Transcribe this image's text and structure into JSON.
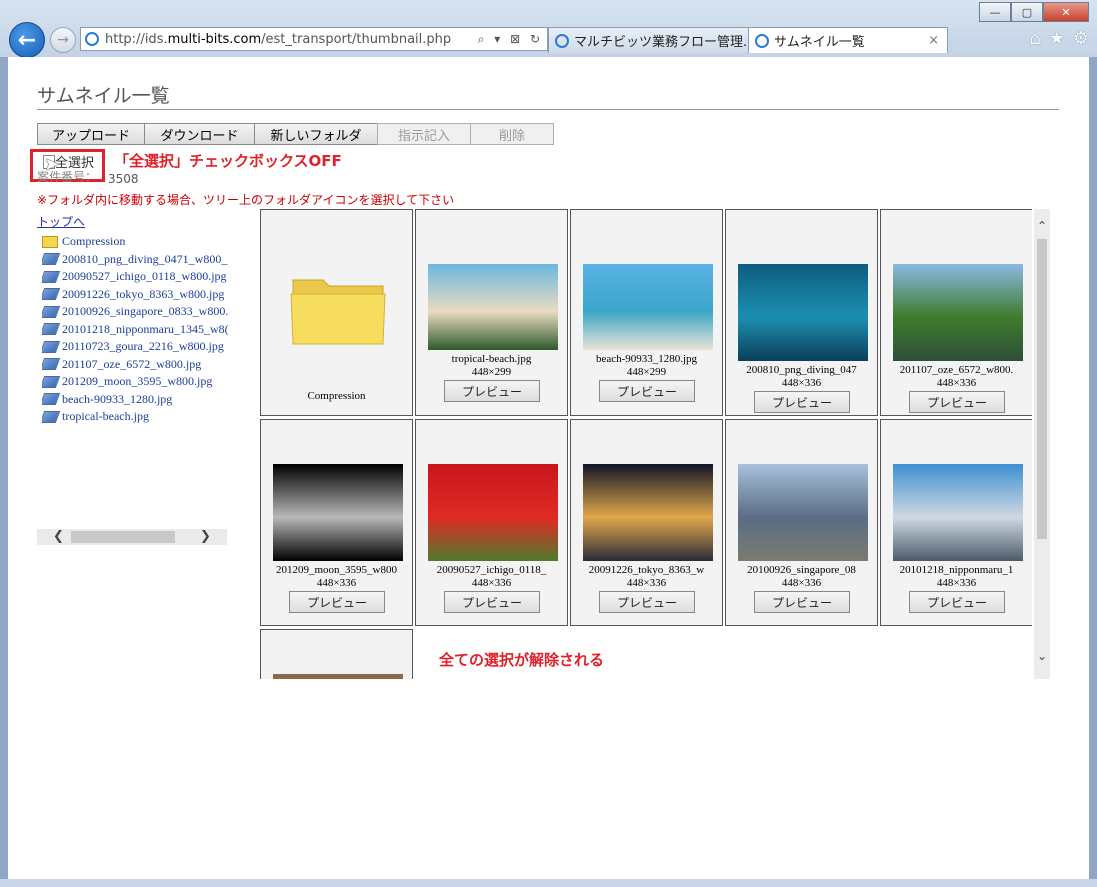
{
  "browser": {
    "url_prefix": "http://ids.",
    "url_host": "multi-bits.com",
    "url_path": "/est_transport/thumbnail.php",
    "url_tools": "⌕ ▾ ⊠ ↻",
    "tabs": [
      {
        "label": "マルチビッツ業務フロー管理..."
      },
      {
        "label": "サムネイル一覧",
        "close": "×"
      }
    ],
    "window_controls": [
      "—",
      "▢",
      "✕"
    ],
    "back_glyph": "←",
    "fwd_glyph": "→",
    "home_glyph": "⌂",
    "star_glyph": "★",
    "gear_glyph": "⚙"
  },
  "page": {
    "title": "サムネイル一覧",
    "toolbar": {
      "upload": "アップロード",
      "download": "ダウンロード",
      "new_folder": "新しいフォルダ",
      "instruction": "指示記入",
      "delete": "削除"
    },
    "select_all_label": "全選択",
    "count_label": "案件番号：",
    "count_value": "3508",
    "annotation_top": "「全選択」チェックボックスOFF",
    "warning": "※フォルダ内に移動する場合、ツリー上のフォルダアイコンを選択して下さい",
    "to_top": "トップへ",
    "annotation_bottom": "全ての選択が解除される"
  },
  "tree": [
    {
      "label": "Compression",
      "icon": "folder-icon"
    },
    {
      "label": "200810_png_diving_0471_w800_",
      "icon": "image-file-icon"
    },
    {
      "label": "20090527_ichigo_0118_w800.jpg",
      "icon": "image-file-icon"
    },
    {
      "label": "20091226_tokyo_8363_w800.jpg",
      "icon": "image-file-icon"
    },
    {
      "label": "20100926_singapore_0833_w800.",
      "icon": "image-file-icon"
    },
    {
      "label": "20101218_nipponmaru_1345_w8(",
      "icon": "image-file-icon"
    },
    {
      "label": "20110723_goura_2216_w800.jpg",
      "icon": "image-file-icon"
    },
    {
      "label": "201107_oze_6572_w800.jpg",
      "icon": "image-file-icon"
    },
    {
      "label": "201209_moon_3595_w800.jpg",
      "icon": "image-file-icon"
    },
    {
      "label": "beach-90933_1280.jpg",
      "icon": "image-file-icon"
    },
    {
      "label": "tropical-beach.jpg",
      "icon": "image-file-icon"
    }
  ],
  "thumbnails": [
    {
      "name": "Compression",
      "type": "folder"
    },
    {
      "name": "tropical-beach.jpg",
      "dim": "448×299",
      "preview": "プレビュー",
      "colors": [
        "#6bb7e0",
        "#e9dcc2",
        "#2f5a2a"
      ]
    },
    {
      "name": "beach-90933_1280.jpg",
      "dim": "448×299",
      "preview": "プレビュー",
      "colors": [
        "#5ab2e6",
        "#3aa6c8",
        "#e9e3d4"
      ]
    },
    {
      "name": "200810_png_diving_047",
      "dim": "448×336",
      "preview": "プレビュー",
      "colors": [
        "#0e5d7e",
        "#1b8fb0",
        "#0b3f5a"
      ]
    },
    {
      "name": "201107_oze_6572_w800.",
      "dim": "448×336",
      "preview": "プレビュー",
      "colors": [
        "#8bb9e2",
        "#3e7b2c",
        "#2d4f3a"
      ]
    },
    {
      "name": "201209_moon_3595_w800",
      "dim": "448×336",
      "preview": "プレビュー",
      "colors": [
        "#000000",
        "#b9b9b9",
        "#000000"
      ]
    },
    {
      "name": "20090527_ichigo_0118_",
      "dim": "448×336",
      "preview": "プレビュー",
      "colors": [
        "#c8161c",
        "#e02a24",
        "#4f7a2e"
      ]
    },
    {
      "name": "20091226_tokyo_8363_w",
      "dim": "448×336",
      "preview": "プレビュー",
      "colors": [
        "#111527",
        "#e2a84a",
        "#2a2a3a"
      ]
    },
    {
      "name": "20100926_singapore_08",
      "dim": "448×336",
      "preview": "プレビュー",
      "colors": [
        "#a9c1dc",
        "#5a6d84",
        "#7b7b6f"
      ]
    },
    {
      "name": "20101218_nipponmaru_1",
      "dim": "448×336",
      "preview": "プレビュー",
      "colors": [
        "#3f8fd2",
        "#cfd9e3",
        "#4b5b6a"
      ]
    }
  ]
}
